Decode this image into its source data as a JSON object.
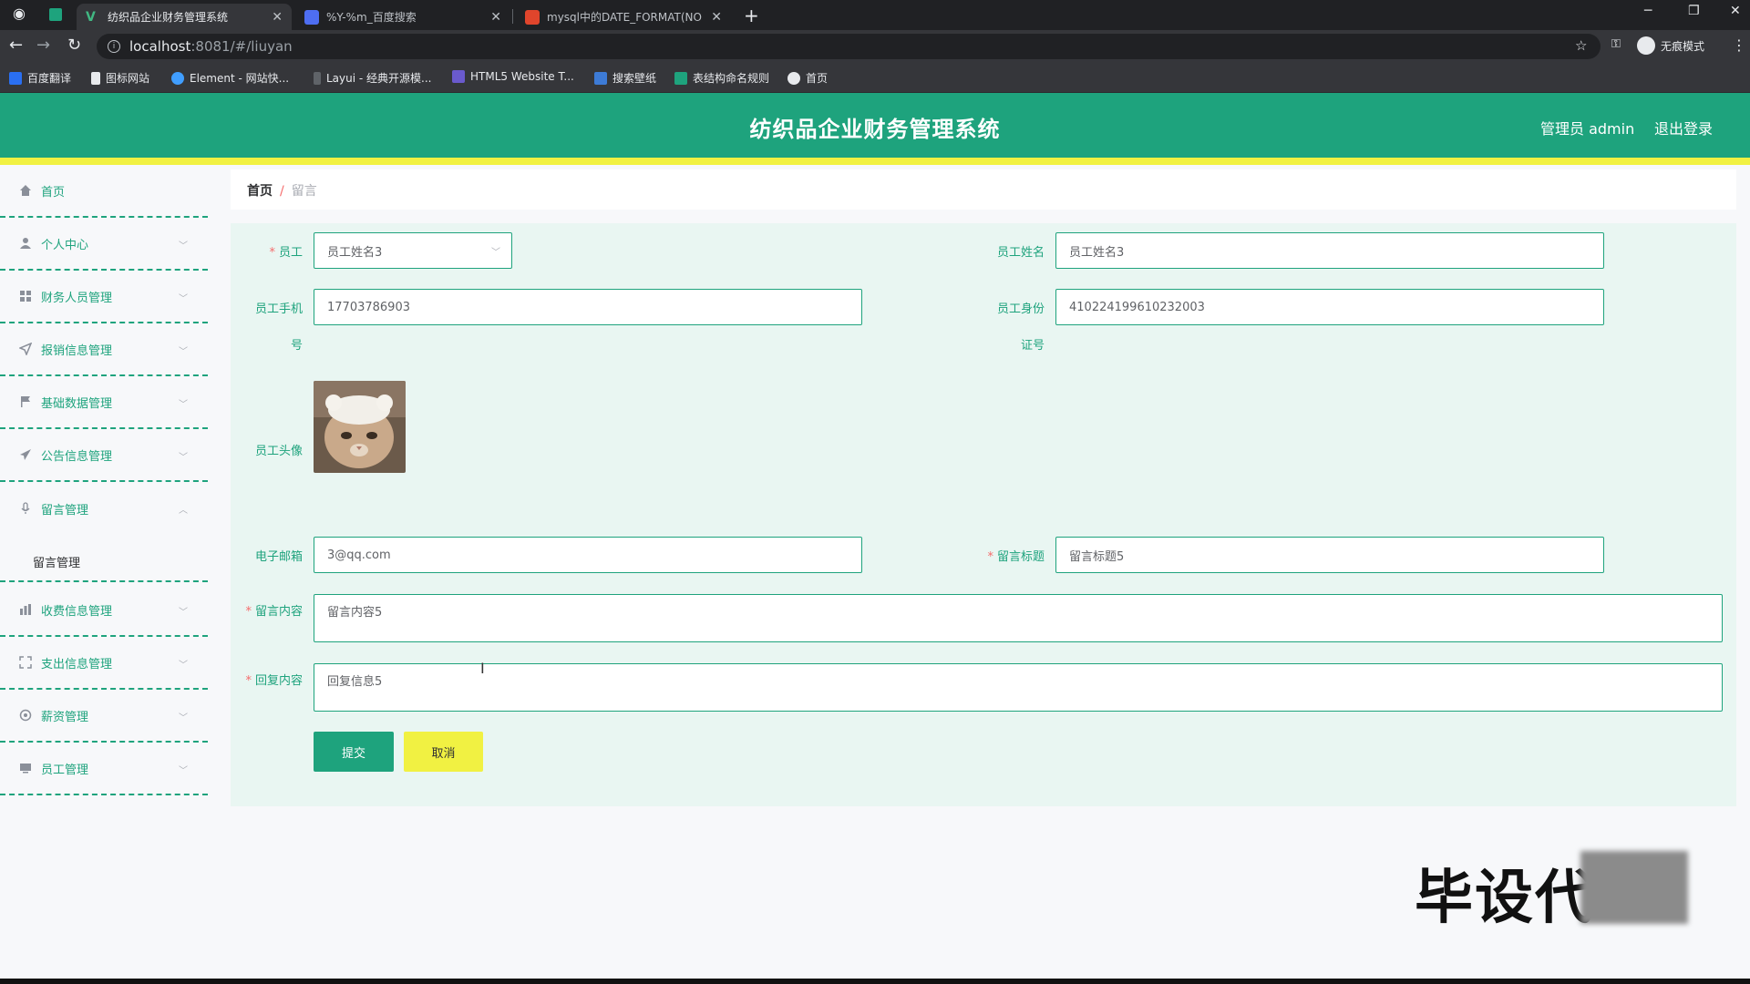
{
  "browser": {
    "tabs": [
      {
        "title": "纺织品企业财务管理系统",
        "active": true
      },
      {
        "title": "%Y-%m_百度搜索",
        "active": false
      },
      {
        "title": "mysql中的DATE_FORMAT(NO",
        "active": false
      }
    ],
    "new_tab": "+",
    "url_host": "localhost",
    "url_path": ":8081/#/liuyan",
    "incognito_label": "无痕模式",
    "bookmarks": [
      "百度翻译",
      "图标网站",
      "Element - 网站快...",
      "Layui - 经典开源模...",
      "HTML5 Website T...",
      "搜索壁纸",
      "表结构命名规则",
      "首页"
    ]
  },
  "app": {
    "title": "纺织品企业财务管理系统",
    "user_label": "管理员 admin",
    "logout_label": "退出登录"
  },
  "sidebar": {
    "items": [
      {
        "label": "首页",
        "icon": "home-icon"
      },
      {
        "label": "个人中心",
        "icon": "user-icon"
      },
      {
        "label": "财务人员管理",
        "icon": "grid-icon"
      },
      {
        "label": "报销信息管理",
        "icon": "send-icon"
      },
      {
        "label": "基础数据管理",
        "icon": "flag-icon"
      },
      {
        "label": "公告信息管理",
        "icon": "paper-plane-icon"
      },
      {
        "label": "留言管理",
        "icon": "mic-icon"
      },
      {
        "label": "收费信息管理",
        "icon": "chart-icon"
      },
      {
        "label": "支出信息管理",
        "icon": "fullscreen-icon"
      },
      {
        "label": "薪资管理",
        "icon": "circle-icon"
      },
      {
        "label": "员工管理",
        "icon": "monitor-icon"
      }
    ],
    "sub_item": "留言管理"
  },
  "breadcrumb": {
    "home": "首页",
    "separator": "/",
    "current": "留言"
  },
  "form": {
    "employee_label": "员工",
    "employee_value": "员工姓名3",
    "employee_name_label": "员工姓名",
    "employee_name_value": "员工姓名3",
    "phone_label_1": "员工手机",
    "phone_label_2": "号",
    "phone_value": "17703786903",
    "idcard_label_1": "员工身份",
    "idcard_label_2": "证号",
    "idcard_value": "410224199610232003",
    "avatar_label": "员工头像",
    "email_label": "电子邮箱",
    "email_value": "3@qq.com",
    "msg_title_label": "留言标题",
    "msg_title_value": "留言标题5",
    "msg_content_label": "留言内容",
    "msg_content_value": "留言内容5",
    "reply_label": "回复内容",
    "reply_value": "回复信息5",
    "required_mark": "*",
    "submit_label": "提交",
    "cancel_label": "取消"
  },
  "watermark": "毕设代"
}
